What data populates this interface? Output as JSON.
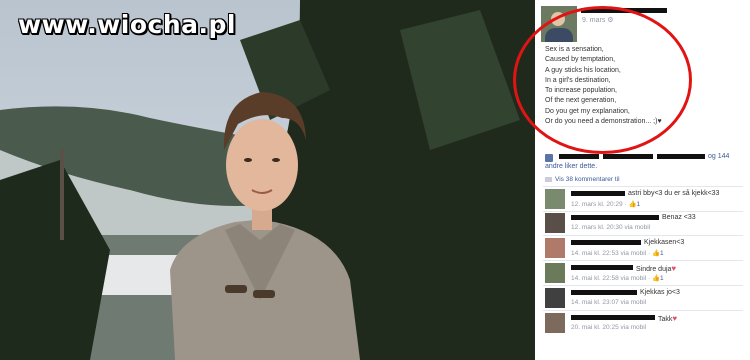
{
  "watermark": "www.wiocha.pl",
  "post": {
    "date": "9. mars",
    "poem": "Sex is a sensation,\nCaused by temptation,\nA guy sticks his location,\nIn a girl's destination,\nTo increase population,\nOf the next generation,\nDo you get my explanation,\nOr do you need a demonstration... ;)♥"
  },
  "likes": {
    "tail": "og 144",
    "line2": "andre liker dette."
  },
  "view_comments": "Vis 38 kommentarer til",
  "comments": [
    {
      "text": "astri bby<3 du er så kjekk<33",
      "meta": "12. mars kl. 20:29 ·",
      "likes": "1"
    },
    {
      "text": "Benaz <33",
      "meta": "12. mars kl. 20:30 via mobil",
      "likes": ""
    },
    {
      "text": "Kjekkasen<3",
      "meta": "14. mai kl. 22:53 via mobil ·",
      "likes": "1"
    },
    {
      "text": "Sindre duja",
      "meta": "14. mai kl. 22:58 via mobil ·",
      "likes": "1"
    },
    {
      "text": "Kjekkas jo<3",
      "meta": "14. mai kl. 23:07 via mobil",
      "likes": ""
    },
    {
      "text": "Takk",
      "meta": "20. mai kl. 20:25 via mobil",
      "likes": ""
    }
  ]
}
